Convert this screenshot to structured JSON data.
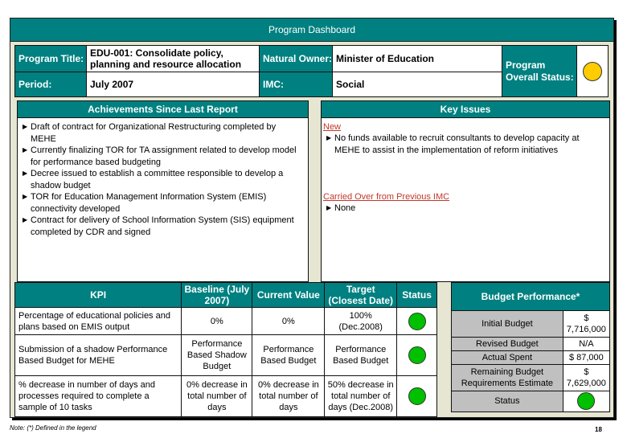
{
  "header": {
    "title": "Program Dashboard"
  },
  "info": {
    "program_title_label": "Program Title:",
    "program_title_value": "EDU-001: Consolidate policy, planning and resource allocation",
    "period_label": "Period:",
    "period_value": "July 2007",
    "natural_owner_label": "Natural Owner:",
    "natural_owner_value": "Minister of Education",
    "imc_label": "IMC:",
    "imc_value": "Social",
    "overall_status_label": "Program Overall Status:",
    "overall_status_color": "#ffcc00"
  },
  "achievements": {
    "title": "Achievements Since Last Report",
    "items": [
      "Draft of contract for Organizational Restructuring completed by MEHE",
      "Currently finalizing TOR for TA assignment related to develop model for performance based budgeting",
      "Decree issued to establish a committee responsible to develop a shadow budget",
      "TOR for Education Management Information System (EMIS) connectivity developed",
      "Contract for delivery of School Information System (SIS) equipment completed by CDR and signed"
    ]
  },
  "key_issues": {
    "title": "Key Issues",
    "new_label": "New",
    "new_items": [
      "No funds available to recruit consultants to develop capacity at MEHE to assist in the implementation of reform initiatives"
    ],
    "carried_label": "Carried Over from Previous IMC",
    "carried_items": [
      "None"
    ]
  },
  "kpi": {
    "headers": [
      "KPI",
      "Baseline (July 2007)",
      "Current Value",
      "Target (Closest Date)",
      "Status"
    ],
    "rows": [
      {
        "kpi": "Percentage of educational policies and plans based on EMIS output",
        "baseline": "0%",
        "current": "0%",
        "target": "100% (Dec.2008)",
        "status_color": "#00c000"
      },
      {
        "kpi": "Submission of a shadow Performance Based Budget for MEHE",
        "baseline": "Performance Based Shadow Budget",
        "current": "Performance Based Budget",
        "target": "Performance Based Budget",
        "status_color": "#00c000"
      },
      {
        "kpi": "% decrease in number of days and processes required to complete a sample of 10 tasks",
        "baseline": "0% decrease in total number of days",
        "current": "0% decrease in total number of days",
        "target": "50% decrease in total number of days (Dec.2008)",
        "status_color": "#00c000"
      }
    ]
  },
  "budget": {
    "title": "Budget Performance*",
    "rows": [
      {
        "label": "Initial Budget",
        "value": "$ 7,716,000"
      },
      {
        "label": "Revised Budget",
        "value": "N/A"
      },
      {
        "label": "Actual Spent",
        "value": "$ 87,000"
      },
      {
        "label": "Remaining Budget Requirements Estimate",
        "value": "$ 7,629,000"
      }
    ],
    "status_label": "Status",
    "status_color": "#00c000"
  },
  "footer": {
    "note": "Note:  (*) Defined in the legend",
    "page_number": "18"
  }
}
